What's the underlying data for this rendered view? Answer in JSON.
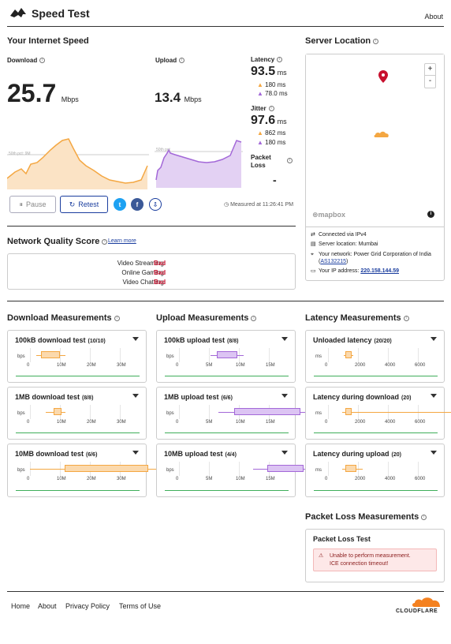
{
  "header": {
    "title": "Speed Test",
    "about": "About"
  },
  "speed": {
    "title": "Your Internet Speed",
    "download_label": "Download",
    "download_value": "25.7",
    "download_unit": "Mbps",
    "download_gridline": "50th pct: 9M",
    "upload_label": "Upload",
    "upload_value": "13.4",
    "upload_unit": "Mbps",
    "upload_gridline": "50th pct",
    "latency_label": "Latency",
    "latency_value": "93.5",
    "latency_unit": "ms",
    "latency_down": "180 ms",
    "latency_up": "78.0 ms",
    "jitter_label": "Jitter",
    "jitter_value": "97.6",
    "jitter_unit": "ms",
    "jitter_down": "862 ms",
    "jitter_up": "180 ms",
    "packet_loss_label": "Packet Loss",
    "packet_loss_value": "-",
    "pause": "Pause",
    "retest": "Retest",
    "measured": "Measured at 11:26:41 PM"
  },
  "server": {
    "title": "Server Location",
    "mapbox": "mapbox",
    "zoom_in": "+",
    "zoom_out": "-",
    "connected": "Connected via IPv4",
    "location": "Server location: Mumbai",
    "network_prefix": "Your network: Power Grid Corporation of India (",
    "network_asn": "AS132215",
    "network_suffix": ")",
    "ip_prefix": "Your IP address: ",
    "ip": "220.158.144.59"
  },
  "quality": {
    "title": "Network Quality Score",
    "learn_more": "Learn more",
    "items": [
      {
        "label": "Video Streaming:",
        "value": "Bad"
      },
      {
        "label": "Online Gaming:",
        "value": "Bad"
      },
      {
        "label": "Video Chatting:",
        "value": "Bad"
      }
    ]
  },
  "download_measurements": {
    "title": "Download Measurements",
    "unit": "bps",
    "ticks": [
      "0",
      "10M",
      "20M",
      "30M"
    ],
    "tests": [
      {
        "name": "100kB download test",
        "count": "(10/10)"
      },
      {
        "name": "1MB download test",
        "count": "(8/8)"
      },
      {
        "name": "10MB download test",
        "count": "(6/6)"
      }
    ]
  },
  "upload_measurements": {
    "title": "Upload Measurements",
    "unit": "bps",
    "ticks": [
      "0",
      "5M",
      "10M",
      "15M"
    ],
    "tests": [
      {
        "name": "100kB upload test",
        "count": "(8/8)"
      },
      {
        "name": "1MB upload test",
        "count": "(6/6)"
      },
      {
        "name": "10MB upload test",
        "count": "(4/4)"
      }
    ]
  },
  "latency_measurements": {
    "title": "Latency Measurements",
    "unit": "ms",
    "ticks": [
      "0",
      "2000",
      "4000",
      "6000"
    ],
    "tests": [
      {
        "name": "Unloaded latency",
        "count": "(20/20)"
      },
      {
        "name": "Latency during download",
        "count": "(20)"
      },
      {
        "name": "Latency during upload",
        "count": "(20)"
      }
    ]
  },
  "packet_loss": {
    "title": "Packet Loss Measurements",
    "card_title": "Packet Loss Test",
    "error_line1": "Unable to perform measurement.",
    "error_line2": "ICE connection timeout!"
  },
  "footer": {
    "home": "Home",
    "about": "About",
    "privacy": "Privacy Policy",
    "terms": "Terms of Use",
    "brand": "CLOUDFLARE"
  },
  "colors": {
    "download": "#f4a742",
    "upload": "#a368d8",
    "bad": "#c8102e",
    "link": "#1a3d9e"
  }
}
